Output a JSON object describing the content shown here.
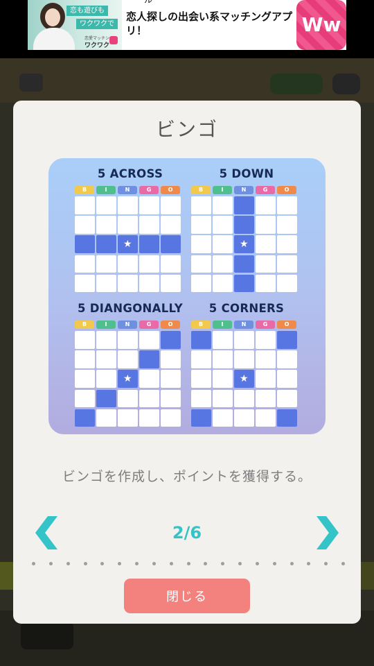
{
  "ad": {
    "tag_line1": "恋も遊びも",
    "tag_line2": "ワクワクで",
    "brand_small": "恋愛マッチング",
    "brand": "ワクワク",
    "title_cut": "ルー",
    "title": "恋人探しの出会い系マッチングアプリ！",
    "logo_text": "Ww"
  },
  "dialog": {
    "title": "ビンゴ",
    "description": "ビンゴを作成し、ポイントを獲得する。",
    "page_indicator": "2/6",
    "close_label": "閉じる",
    "dot_count": 19
  },
  "bingo_header_letters": [
    "B",
    "I",
    "N",
    "G",
    "O"
  ],
  "bingo_header_colors": [
    "#f2c94c",
    "#4fc08d",
    "#6f8fe0",
    "#e86aa6",
    "#f08a4b"
  ],
  "patterns": [
    {
      "label": "5 ACROSS",
      "filled": [
        [
          2,
          0
        ],
        [
          2,
          1
        ],
        [
          2,
          3
        ],
        [
          2,
          4
        ]
      ],
      "star": [
        2,
        2
      ]
    },
    {
      "label": "5 DOWN",
      "filled": [
        [
          0,
          2
        ],
        [
          1,
          2
        ],
        [
          3,
          2
        ],
        [
          4,
          2
        ]
      ],
      "star": [
        2,
        2
      ]
    },
    {
      "label": "5 DIANGONALLY",
      "filled": [
        [
          0,
          4
        ],
        [
          1,
          3
        ],
        [
          3,
          1
        ],
        [
          4,
          0
        ]
      ],
      "star": [
        2,
        2
      ]
    },
    {
      "label": "5 CORNERS",
      "filled": [
        [
          0,
          0
        ],
        [
          0,
          4
        ],
        [
          4,
          0
        ],
        [
          4,
          4
        ]
      ],
      "star": [
        2,
        2
      ]
    }
  ],
  "colors": {
    "accent_teal": "#34c3c6",
    "close_button": "#f3817e",
    "filled_cell": "#5876e2",
    "label_navy": "#162a55"
  },
  "icons": {
    "prev": "chevron-left-icon",
    "next": "chevron-right-icon",
    "center": "star-icon"
  }
}
